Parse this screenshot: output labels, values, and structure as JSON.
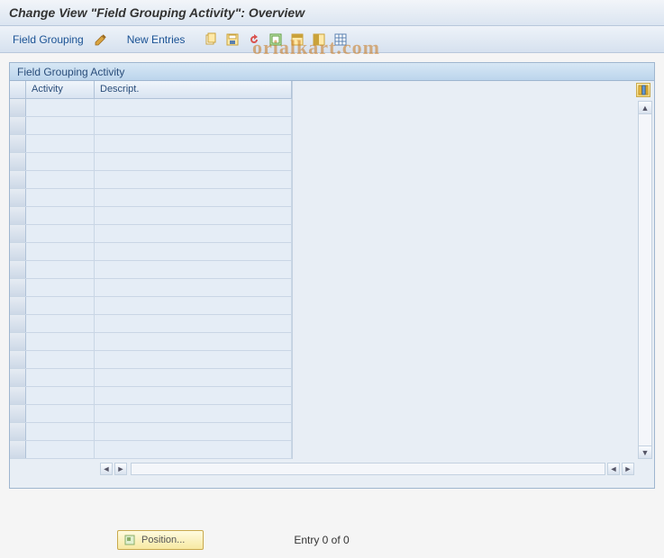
{
  "title": "Change View \"Field Grouping Activity\": Overview",
  "toolbar": {
    "field_grouping_label": "Field Grouping",
    "new_entries_label": "New Entries",
    "icons": {
      "pencil": "pencil-icon",
      "copy": "copy-icon",
      "save": "save-icon",
      "undo": "undo-icon",
      "select_all": "select-all-icon",
      "deselect": "deselect-icon",
      "table_settings": "table-settings-icon"
    }
  },
  "watermark": "orialkart.com",
  "panel": {
    "title": "Field Grouping Activity",
    "columns": {
      "activity": "Activity",
      "descript": "Descript."
    },
    "rows": [
      {
        "activity": "",
        "descript": ""
      },
      {
        "activity": "",
        "descript": ""
      },
      {
        "activity": "",
        "descript": ""
      },
      {
        "activity": "",
        "descript": ""
      },
      {
        "activity": "",
        "descript": ""
      },
      {
        "activity": "",
        "descript": ""
      },
      {
        "activity": "",
        "descript": ""
      },
      {
        "activity": "",
        "descript": ""
      },
      {
        "activity": "",
        "descript": ""
      },
      {
        "activity": "",
        "descript": ""
      },
      {
        "activity": "",
        "descript": ""
      },
      {
        "activity": "",
        "descript": ""
      },
      {
        "activity": "",
        "descript": ""
      },
      {
        "activity": "",
        "descript": ""
      },
      {
        "activity": "",
        "descript": ""
      },
      {
        "activity": "",
        "descript": ""
      },
      {
        "activity": "",
        "descript": ""
      },
      {
        "activity": "",
        "descript": ""
      },
      {
        "activity": "",
        "descript": ""
      },
      {
        "activity": "",
        "descript": ""
      }
    ]
  },
  "footer": {
    "position_label": "Position...",
    "entry_text": "Entry 0 of 0"
  }
}
